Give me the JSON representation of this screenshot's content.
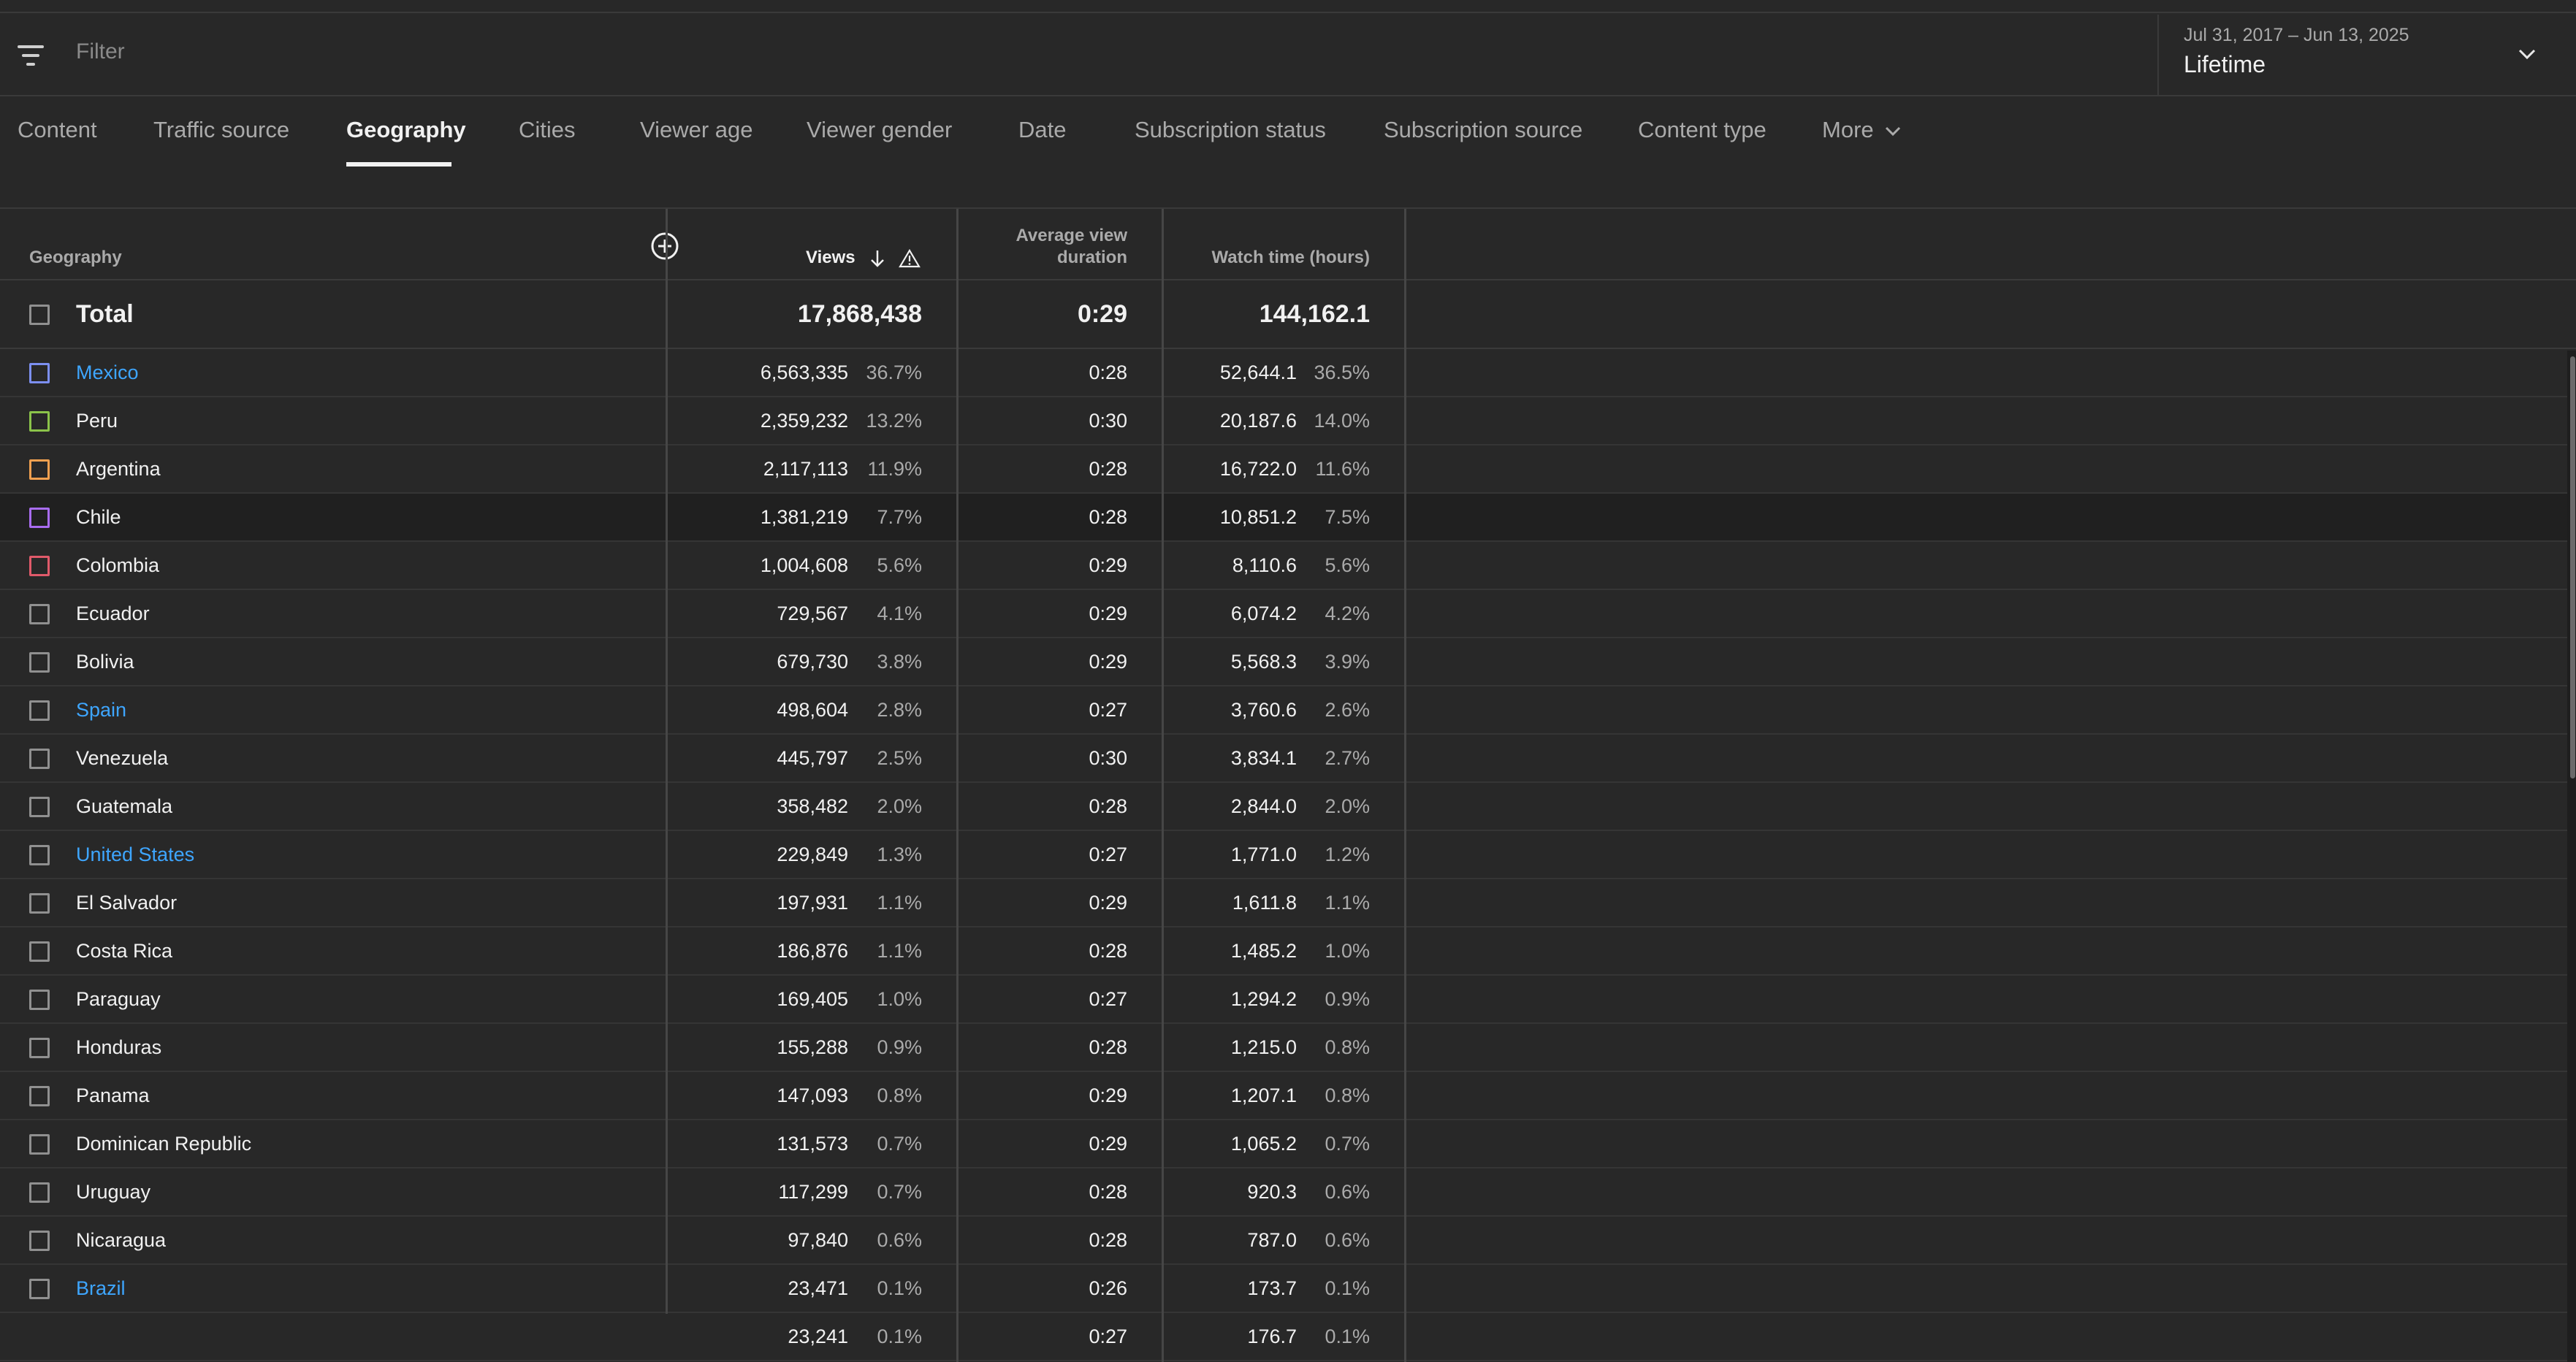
{
  "filter": {
    "placeholder": "Filter"
  },
  "date": {
    "range": "Jul 31, 2017 – Jun 13, 2025",
    "preset": "Lifetime"
  },
  "tabs": [
    {
      "label": "Content",
      "active": false
    },
    {
      "label": "Traffic source",
      "active": false
    },
    {
      "label": "Geography",
      "active": true
    },
    {
      "label": "Cities",
      "active": false
    },
    {
      "label": "Viewer age",
      "active": false
    },
    {
      "label": "Viewer gender",
      "active": false
    },
    {
      "label": "Date",
      "active": false
    },
    {
      "label": "Subscription status",
      "active": false
    },
    {
      "label": "Subscription source",
      "active": false
    },
    {
      "label": "Content type",
      "active": false
    },
    {
      "label": "More",
      "active": false
    }
  ],
  "table": {
    "headers": {
      "geography": "Geography",
      "views": "Views",
      "avg_duration_line1": "Average view",
      "avg_duration_line2": "duration",
      "watch_time": "Watch time (hours)"
    },
    "sort": {
      "column": "Views",
      "direction": "descending"
    },
    "total": {
      "label": "Total",
      "views": "17,868,438",
      "avg_duration": "0:29",
      "watch_time": "144,162.1"
    },
    "rows": [
      {
        "name": "Mexico",
        "link": true,
        "checkbox_color": "#7c8ff0",
        "views": "6,563,335",
        "views_pct": "36.7%",
        "avg_duration": "0:28",
        "watch_time": "52,644.1",
        "watch_pct": "36.5%"
      },
      {
        "name": "Peru",
        "link": false,
        "checkbox_color": "#8bc34a",
        "views": "2,359,232",
        "views_pct": "13.2%",
        "avg_duration": "0:30",
        "watch_time": "20,187.6",
        "watch_pct": "14.0%"
      },
      {
        "name": "Argentina",
        "link": false,
        "checkbox_color": "#f0a050",
        "views": "2,117,113",
        "views_pct": "11.9%",
        "avg_duration": "0:28",
        "watch_time": "16,722.0",
        "watch_pct": "11.6%"
      },
      {
        "name": "Chile",
        "link": false,
        "checkbox_color": "#a86cf0",
        "views": "1,381,219",
        "views_pct": "7.7%",
        "avg_duration": "0:28",
        "watch_time": "10,851.2",
        "watch_pct": "7.5%"
      },
      {
        "name": "Colombia",
        "link": false,
        "checkbox_color": "#e05a6a",
        "views": "1,004,608",
        "views_pct": "5.6%",
        "avg_duration": "0:29",
        "watch_time": "8,110.6",
        "watch_pct": "5.6%"
      },
      {
        "name": "Ecuador",
        "link": false,
        "checkbox_color": "#909090",
        "views": "729,567",
        "views_pct": "4.1%",
        "avg_duration": "0:29",
        "watch_time": "6,074.2",
        "watch_pct": "4.2%"
      },
      {
        "name": "Bolivia",
        "link": false,
        "checkbox_color": "#909090",
        "views": "679,730",
        "views_pct": "3.8%",
        "avg_duration": "0:29",
        "watch_time": "5,568.3",
        "watch_pct": "3.9%"
      },
      {
        "name": "Spain",
        "link": true,
        "checkbox_color": "#909090",
        "views": "498,604",
        "views_pct": "2.8%",
        "avg_duration": "0:27",
        "watch_time": "3,760.6",
        "watch_pct": "2.6%"
      },
      {
        "name": "Venezuela",
        "link": false,
        "checkbox_color": "#909090",
        "views": "445,797",
        "views_pct": "2.5%",
        "avg_duration": "0:30",
        "watch_time": "3,834.1",
        "watch_pct": "2.7%"
      },
      {
        "name": "Guatemala",
        "link": false,
        "checkbox_color": "#909090",
        "views": "358,482",
        "views_pct": "2.0%",
        "avg_duration": "0:28",
        "watch_time": "2,844.0",
        "watch_pct": "2.0%"
      },
      {
        "name": "United States",
        "link": true,
        "checkbox_color": "#909090",
        "views": "229,849",
        "views_pct": "1.3%",
        "avg_duration": "0:27",
        "watch_time": "1,771.0",
        "watch_pct": "1.2%"
      },
      {
        "name": "El Salvador",
        "link": false,
        "checkbox_color": "#909090",
        "views": "197,931",
        "views_pct": "1.1%",
        "avg_duration": "0:29",
        "watch_time": "1,611.8",
        "watch_pct": "1.1%"
      },
      {
        "name": "Costa Rica",
        "link": false,
        "checkbox_color": "#909090",
        "views": "186,876",
        "views_pct": "1.1%",
        "avg_duration": "0:28",
        "watch_time": "1,485.2",
        "watch_pct": "1.0%"
      },
      {
        "name": "Paraguay",
        "link": false,
        "checkbox_color": "#909090",
        "views": "169,405",
        "views_pct": "1.0%",
        "avg_duration": "0:27",
        "watch_time": "1,294.2",
        "watch_pct": "0.9%"
      },
      {
        "name": "Honduras",
        "link": false,
        "checkbox_color": "#909090",
        "views": "155,288",
        "views_pct": "0.9%",
        "avg_duration": "0:28",
        "watch_time": "1,215.0",
        "watch_pct": "0.8%"
      },
      {
        "name": "Panama",
        "link": false,
        "checkbox_color": "#909090",
        "views": "147,093",
        "views_pct": "0.8%",
        "avg_duration": "0:29",
        "watch_time": "1,207.1",
        "watch_pct": "0.8%"
      },
      {
        "name": "Dominican Republic",
        "link": false,
        "checkbox_color": "#909090",
        "views": "131,573",
        "views_pct": "0.7%",
        "avg_duration": "0:29",
        "watch_time": "1,065.2",
        "watch_pct": "0.7%"
      },
      {
        "name": "Uruguay",
        "link": false,
        "checkbox_color": "#909090",
        "views": "117,299",
        "views_pct": "0.7%",
        "avg_duration": "0:28",
        "watch_time": "920.3",
        "watch_pct": "0.6%"
      },
      {
        "name": "Nicaragua",
        "link": false,
        "checkbox_color": "#909090",
        "views": "97,840",
        "views_pct": "0.6%",
        "avg_duration": "0:28",
        "watch_time": "787.0",
        "watch_pct": "0.6%"
      },
      {
        "name": "Brazil",
        "link": true,
        "checkbox_color": "#909090",
        "views": "23,471",
        "views_pct": "0.1%",
        "avg_duration": "0:26",
        "watch_time": "173.7",
        "watch_pct": "0.1%"
      },
      {
        "name": "",
        "link": false,
        "checkbox_color": "",
        "views": "23,241",
        "views_pct": "0.1%",
        "avg_duration": "0:27",
        "watch_time": "176.7",
        "watch_pct": "0.1%"
      }
    ]
  }
}
